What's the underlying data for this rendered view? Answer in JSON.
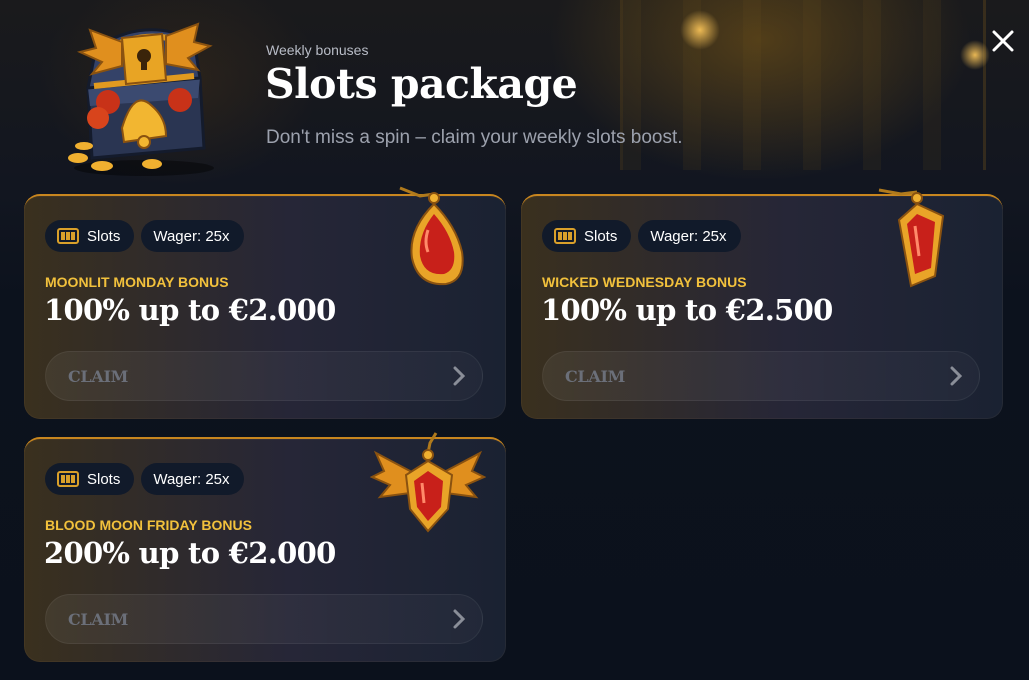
{
  "header": {
    "eyebrow": "Weekly bonuses",
    "title": "Slots package",
    "subtitle": "Don't miss a spin – claim your weekly slots boost."
  },
  "close_icon": "close-icon",
  "hero_image": "treasure-chest-icon",
  "colors": {
    "accent_gold": "#f2c13c",
    "card_border": "#c8861f",
    "background": "#0c121d",
    "pendant_red": "#c8201a"
  },
  "cards": [
    {
      "category": "Slots",
      "category_icon": "slot-machine-icon",
      "wager": "Wager: 25x",
      "name": "MOONLIT MONDAY BONUS",
      "amount": "100% up to €2.000",
      "claim_label": "CLAIM",
      "pendant_icon": "red-drop-pendant-icon"
    },
    {
      "category": "Slots",
      "category_icon": "slot-machine-icon",
      "wager": "Wager: 25x",
      "name": "WICKED WEDNESDAY BONUS",
      "amount": "100% up to €2.500",
      "claim_label": "CLAIM",
      "pendant_icon": "red-coffin-pendant-icon"
    },
    {
      "category": "Slots",
      "category_icon": "slot-machine-icon",
      "wager": "Wager: 25x",
      "name": "BLOOD MOON FRIDAY BONUS",
      "amount": "200% up to €2.000",
      "claim_label": "CLAIM",
      "pendant_icon": "winged-heart-pendant-icon"
    }
  ]
}
